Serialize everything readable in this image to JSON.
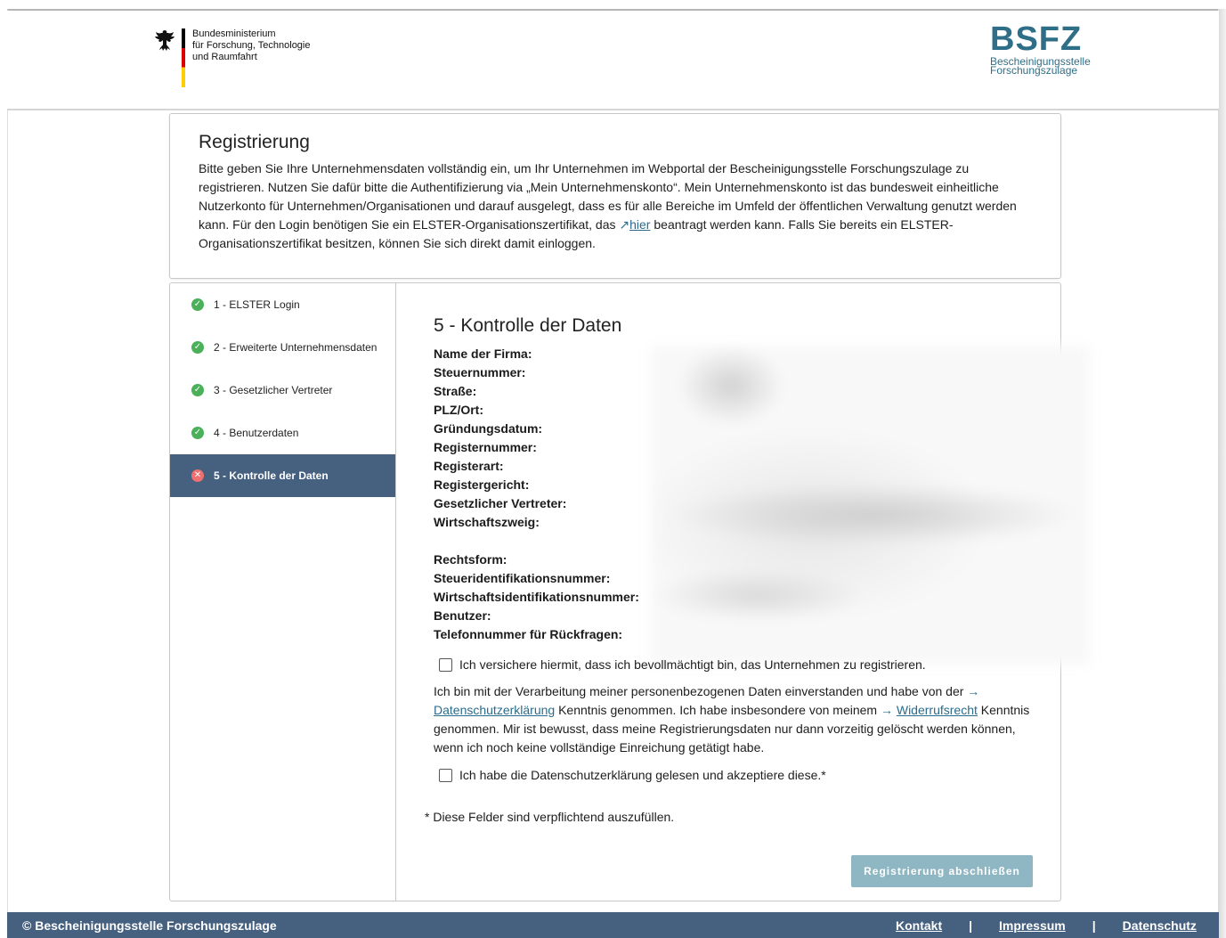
{
  "header": {
    "ministry_lines": [
      "Bundesministerium",
      "für Forschung, Technologie",
      "und Raumfahrt"
    ],
    "logo_word": "BSFZ",
    "logo_sub1": "Bescheinigungsstelle",
    "logo_sub2": "Forschungszulage"
  },
  "intro": {
    "title": "Registrierung",
    "text_before_link": "Bitte geben Sie Ihre Unternehmensdaten vollständig ein, um Ihr Unternehmen im Webportal der Bescheinigungsstelle Forschungszulage zu registrieren. Nutzen Sie dafür bitte die Authentifizierung via „Mein Unternehmenskonto“. Mein Unternehmenskonto ist das bundesweit einheitliche Nutzerkonto für Unternehmen/Organisationen und darauf ausgelegt, dass es für alle Bereiche im Umfeld der öffentlichen Verwaltung genutzt werden kann. Für den Login benötigen Sie ein ELSTER-Organisationszertifikat, das ",
    "link_arrow": "↗",
    "link_text": "hier",
    "text_after_link": " beantragt werden kann. Falls Sie bereits ein ELSTER-Organisationszertifikat besitzen, können Sie sich direkt damit einloggen."
  },
  "steps": [
    {
      "label": "1 - ELSTER Login",
      "status": "done"
    },
    {
      "label": "2 - Erweiterte Unternehmensdaten",
      "status": "done"
    },
    {
      "label": "3 - Gesetzlicher Vertreter",
      "status": "done"
    },
    {
      "label": "4 - Benutzerdaten",
      "status": "done"
    },
    {
      "label": "5 - Kontrolle der Daten",
      "status": "error"
    }
  ],
  "content": {
    "title": "5 - Kontrolle der Daten",
    "fields": {
      "f1": "Name der Firma:",
      "f2": "Steuernummer:",
      "f3": "Straße:",
      "f4": "PLZ/Ort:",
      "f5": "Gründungsdatum:",
      "f6": "Registernummer:",
      "f7": "Registerart:",
      "f8": "Registergericht:",
      "f9": "Gesetzlicher Vertreter:",
      "f10": "Wirtschaftszweig:",
      "f11": "Rechtsform:",
      "f12": "Steueridentifikationsnummer:",
      "f13": "Wirtschaftsidentifikationsnummer:",
      "f14": "Benutzer:",
      "f15": "Telefonnummer für Rückfragen:"
    },
    "checkbox1_label": "Ich versichere hiermit, dass ich bevollmächtigt bin, das Unternehmen zu registrieren.",
    "consent_part1": "Ich bin mit der Verarbeitung meiner personenbezogenen Daten einverstanden und habe von der ",
    "consent_arrow": "→",
    "consent_link1": "Datenschutzerklärung",
    "consent_part2": " Kenntnis genommen. Ich habe insbesondere von meinem ",
    "consent_link2": "Widerrufsrecht",
    "consent_part3": " Kenntnis genommen. Mir ist bewusst, dass meine Registrierungsdaten nur dann vorzeitig gelöscht werden können, wenn ich noch keine vollständige Einreichung getätigt habe.",
    "checkbox2_label": "Ich habe die Datenschutzerklärung gelesen und akzeptiere diese.*",
    "required_note": "* Diese Felder sind verpflichtend auszufüllen.",
    "submit_label": "Registrierung abschließen"
  },
  "footer": {
    "copyright": "© Bescheinigungsstelle Forschungszulage",
    "link_kontakt": "Kontakt",
    "link_impressum": "Impressum",
    "link_datenschutz": "Datenschutz",
    "separator": "|"
  },
  "colors": {
    "brand": "#2f6e87",
    "nav_active": "#46607f",
    "success": "#4bb05a",
    "error": "#f07070",
    "button_disabled": "#8fb6c3"
  }
}
